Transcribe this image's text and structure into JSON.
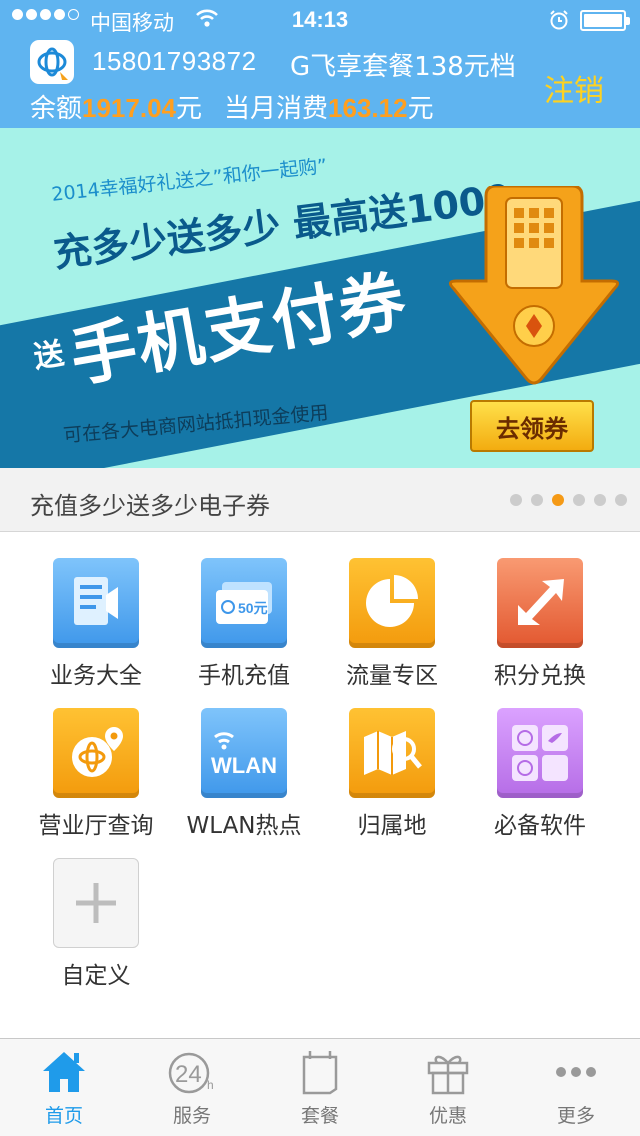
{
  "status_bar": {
    "carrier": "中国移动",
    "time": "14:13"
  },
  "header": {
    "phone_number": "15801793872",
    "plan": "G飞享套餐138元档",
    "logout_label": "注销",
    "balance_label": "余额",
    "balance_value": "1917.04",
    "balance_unit": "元",
    "monthly_label": "当月消费",
    "monthly_value": "163.12",
    "monthly_unit": "元"
  },
  "banner": {
    "subtitle": "2014幸福好礼送之”和你一起购”",
    "promo": "充多少送多少 最高送1000",
    "main_prefix": "送",
    "main": "手机支付券",
    "note": "可在各大电商网站抵扣现金使用",
    "button": "去领券"
  },
  "caption": {
    "text": "充值多少送多少电子券",
    "pages": 6,
    "active_page": 3
  },
  "grid": [
    {
      "label": "业务大全",
      "icon": "business-list-icon"
    },
    {
      "label": "手机充值",
      "icon": "recharge-card-icon",
      "badge": "50元"
    },
    {
      "label": "流量专区",
      "icon": "pie-chart-icon"
    },
    {
      "label": "积分兑换",
      "icon": "exchange-arrows-icon"
    },
    {
      "label": "营业厅查询",
      "icon": "store-location-icon"
    },
    {
      "label": "WLAN热点",
      "icon": "wlan-icon",
      "badge": "WLAN"
    },
    {
      "label": "归属地",
      "icon": "map-search-icon"
    },
    {
      "label": "必备软件",
      "icon": "apps-icon"
    },
    {
      "label": "自定义",
      "icon": "plus-icon"
    }
  ],
  "tabs": [
    {
      "label": "首页",
      "icon": "home-icon",
      "active": true
    },
    {
      "label": "服务",
      "icon": "24h-service-icon",
      "active": false
    },
    {
      "label": "套餐",
      "icon": "package-icon",
      "active": false
    },
    {
      "label": "优惠",
      "icon": "gift-icon",
      "active": false
    },
    {
      "label": "更多",
      "icon": "more-icon",
      "active": false
    }
  ],
  "colors": {
    "header_bg": "#5fb4f0",
    "accent_orange": "#ff9f1f",
    "logout_yellow": "#ffd21f",
    "tab_active": "#1f9bea"
  }
}
